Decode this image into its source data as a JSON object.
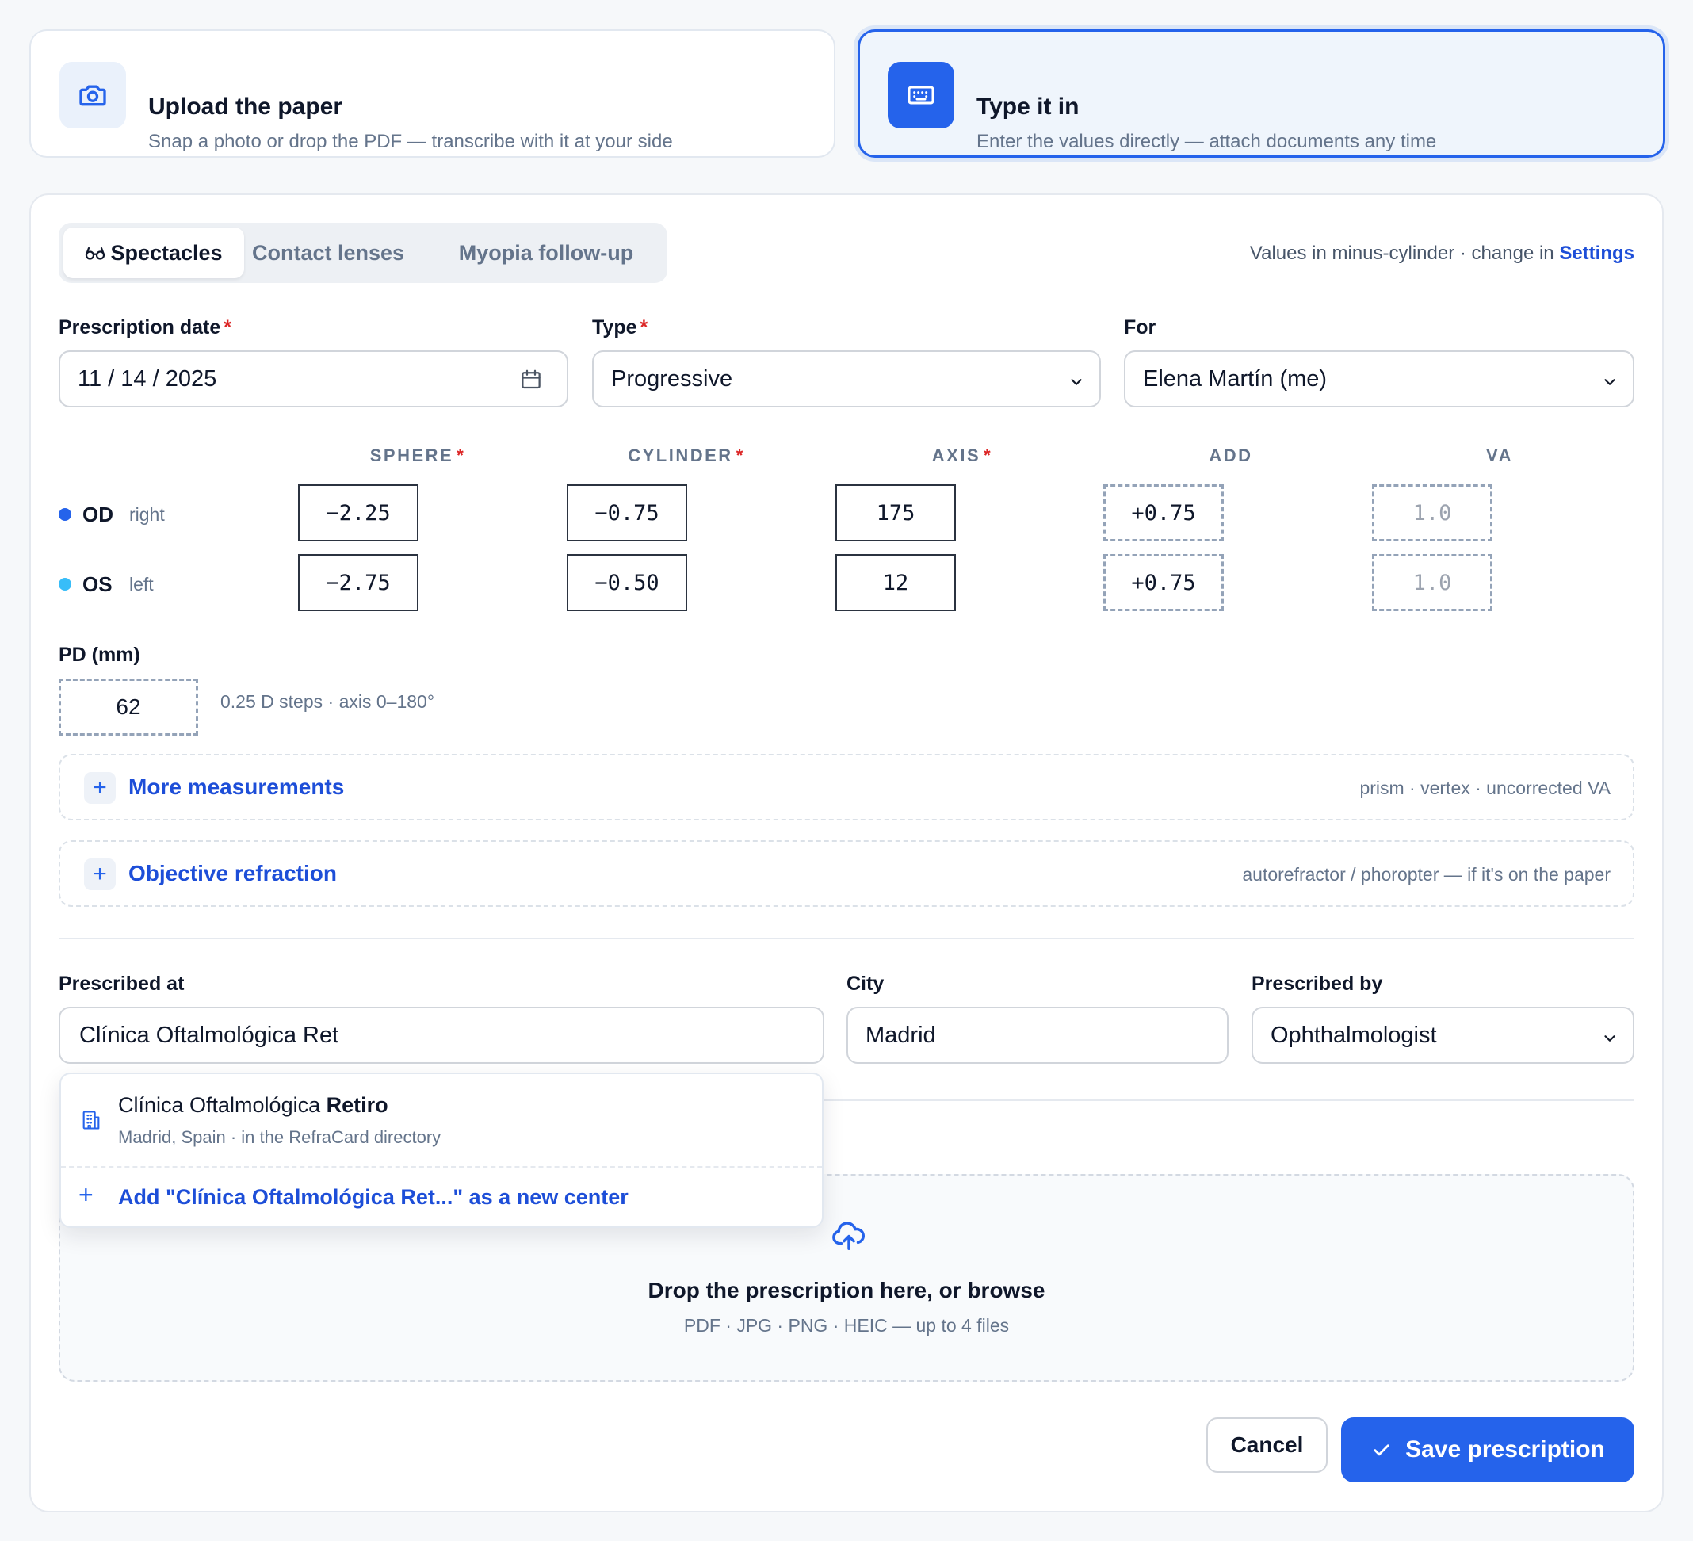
{
  "modes": {
    "upload": {
      "title": "Upload the paper",
      "subtitle": "Snap a photo or drop the PDF — transcribe with it at your side",
      "icon": "camera-icon"
    },
    "type": {
      "title": "Type it in",
      "subtitle": "Enter the values directly — attach documents any time",
      "icon": "keyboard-icon",
      "selected": true
    }
  },
  "tabs": [
    {
      "label": "Spectacles",
      "icon": "glasses-icon",
      "active": true
    },
    {
      "label": "Contact lenses"
    },
    {
      "label": "Myopia follow-up"
    }
  ],
  "cylinder_note": {
    "text": "Values in minus-cylinder · change in ",
    "link": "Settings"
  },
  "fields": {
    "date": {
      "label": "Prescription date",
      "value": "11 / 14 / 2025",
      "required": "*"
    },
    "type": {
      "label": "Type",
      "value": "Progressive",
      "required": "*"
    },
    "for": {
      "label": "For",
      "value": "Elena Martín (me)"
    }
  },
  "rx": {
    "columns": {
      "sphere": "SPHERE",
      "cylinder": "CYLINDER",
      "axis": "AXIS",
      "add": "ADD",
      "va": "VA",
      "required": "*"
    },
    "od": {
      "code": "OD",
      "side": "right",
      "sphere": "−2.25",
      "cylinder": "−0.75",
      "axis": "175",
      "add": "+0.75",
      "va": "1.0"
    },
    "os": {
      "code": "OS",
      "side": "left",
      "sphere": "−2.75",
      "cylinder": "−0.50",
      "axis": "12",
      "add": "+0.75",
      "va": "1.0"
    }
  },
  "pd": {
    "label": "PD (mm)",
    "value": "62",
    "hint": "0.25 D steps · axis 0–180°"
  },
  "sections": {
    "more": {
      "title": "More measurements",
      "note": "prism · vertex · uncorrected VA"
    },
    "objective": {
      "title": "Objective refraction",
      "note": "autorefractor / phoropter — if it's on the paper"
    }
  },
  "location": {
    "at_label": "Prescribed at",
    "at_value": "Clínica Oftalmológica Ret",
    "city_label": "City",
    "city_value": "Madrid",
    "by_label": "Prescribed by",
    "by_value": "Ophthalmologist"
  },
  "suggestion": {
    "name_prefix": "Clínica Oftalmológica ",
    "name_match": "Retiro",
    "detail": "Madrid, Spain · in the RefraCard directory",
    "add_new": "Add \"Clínica Oftalmológica Ret...\" as a new center"
  },
  "dropzone": {
    "title": "Drop the prescription here, or browse",
    "subtitle": "PDF · JPG · PNG · HEIC — up to 4 files"
  },
  "actions": {
    "cancel": "Cancel",
    "save": "Save prescription"
  },
  "colors": {
    "accent": "#2563eb",
    "od_dot": "#2563eb",
    "os_dot": "#38bdf8",
    "required": "#dc2626"
  }
}
